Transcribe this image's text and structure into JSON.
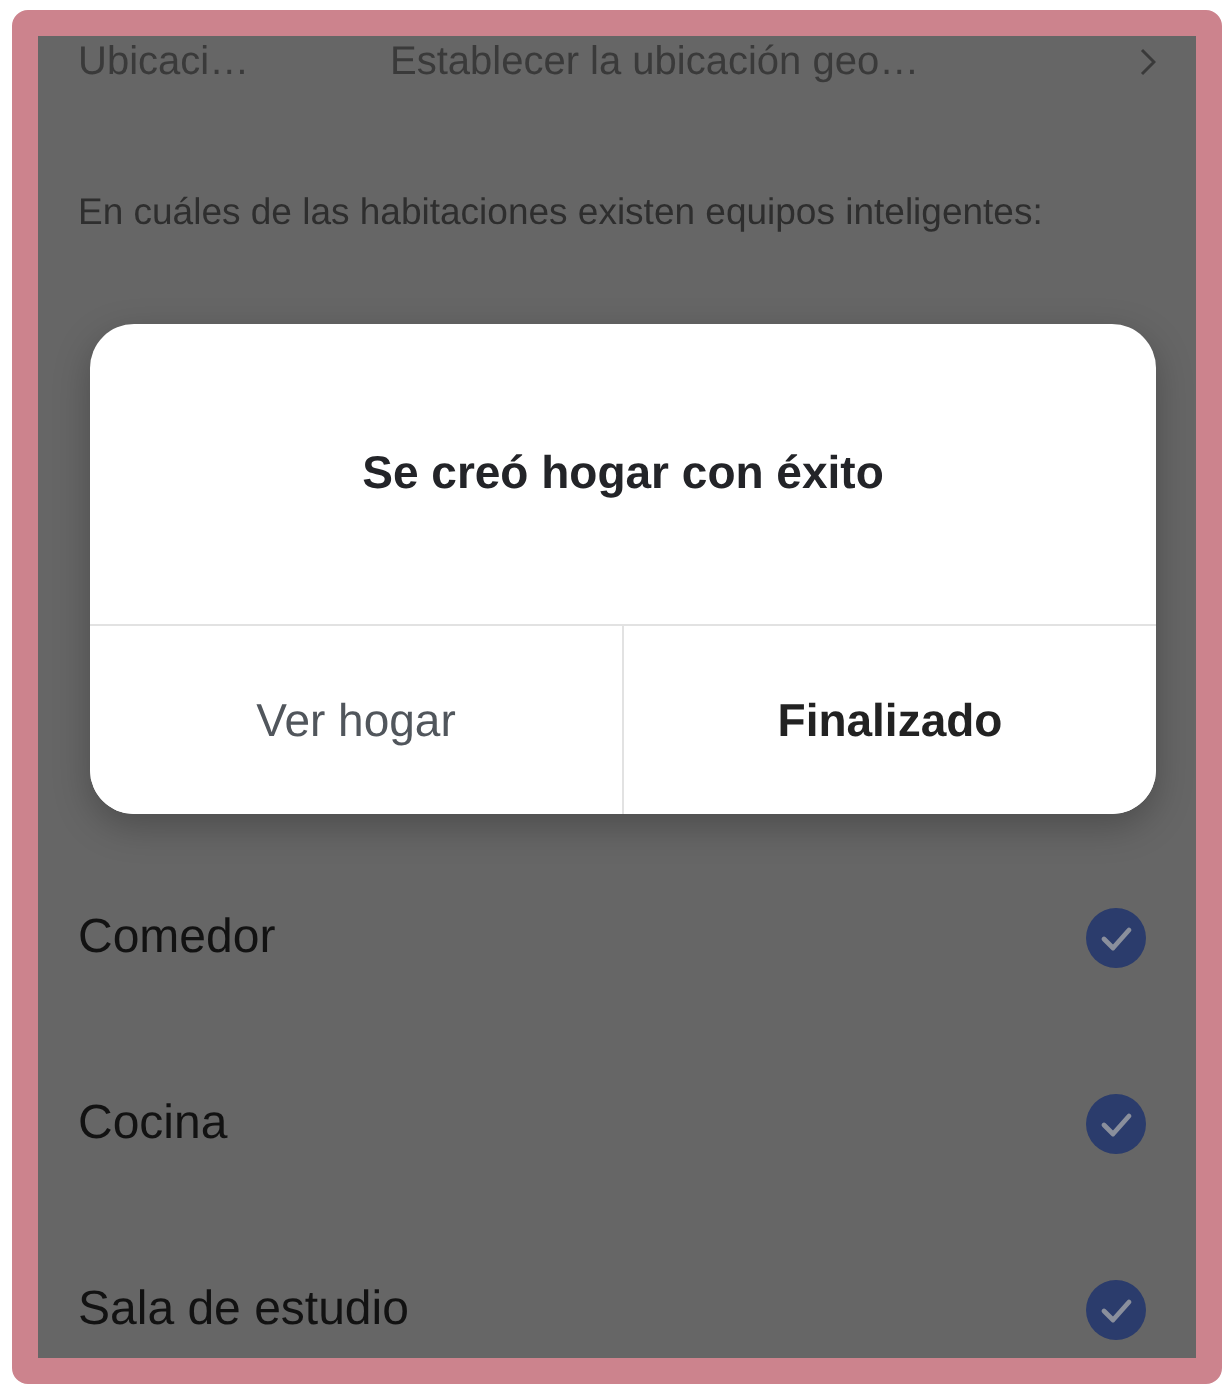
{
  "location_row": {
    "label": "Ubicaci…",
    "value": "Establecer la ubicación geo…"
  },
  "rooms_heading": "En cuáles de las habitaciones existen equipos inteligentes:",
  "rooms": [
    {
      "name": "Comedor",
      "checked": true
    },
    {
      "name": "Cocina",
      "checked": true
    },
    {
      "name": "Sala de estudio",
      "checked": true
    }
  ],
  "dialog": {
    "message": "Se creó hogar con éxito",
    "buttons": [
      {
        "label": "Ver hogar",
        "kind": "secondary"
      },
      {
        "label": "Finalizado",
        "kind": "primary"
      }
    ]
  }
}
